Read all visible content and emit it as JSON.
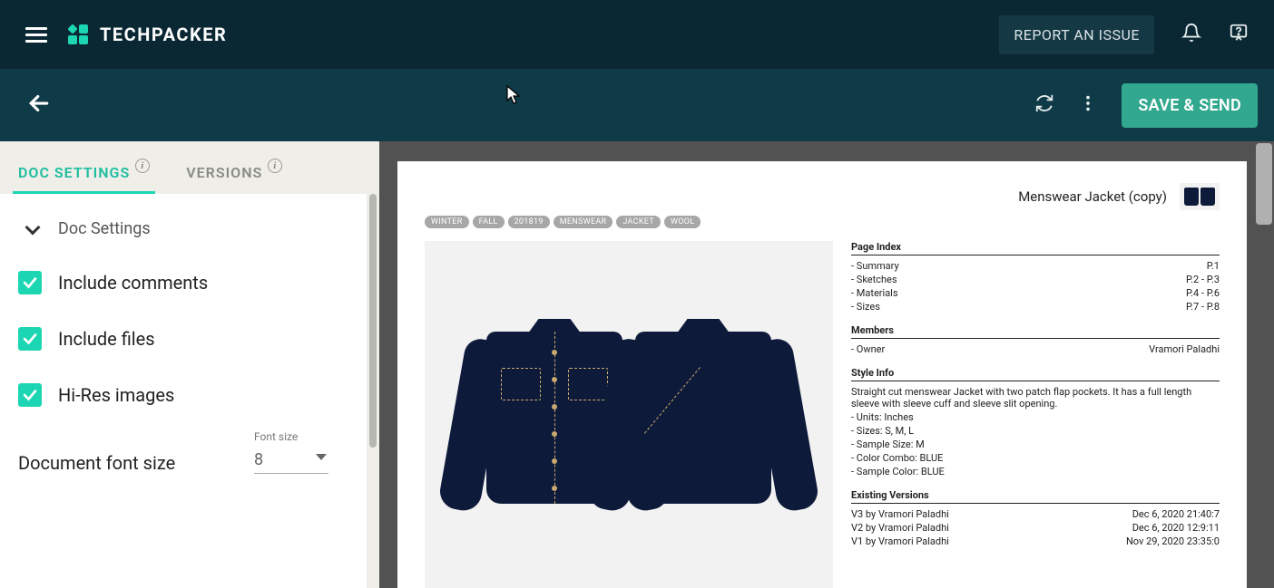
{
  "header": {
    "brand": "TECHPACKER",
    "report_label": "REPORT AN ISSUE"
  },
  "subheader": {
    "save_label": "SAVE & SEND"
  },
  "sidebar": {
    "tabs": {
      "doc_settings": "DOC SETTINGS",
      "versions": "VERSIONS"
    },
    "section_title": "Doc Settings",
    "opts": {
      "comments": "Include comments",
      "files": "Include files",
      "hires": "Hi-Res images"
    },
    "font_size_label": "Document font size",
    "font_size_field_label": "Font size",
    "font_size_value": "8"
  },
  "document": {
    "title": "Menswear Jacket (copy)",
    "tags": [
      "WINTER",
      "FALL",
      "201819",
      "MENSWEAR",
      "JACKET",
      "WOOL"
    ],
    "page_index_header": "Page Index",
    "page_index": [
      {
        "label": "Summary",
        "pages": "P.1"
      },
      {
        "label": "Sketches",
        "pages": "P.2 - P.3"
      },
      {
        "label": "Materials",
        "pages": "P.4 - P.6"
      },
      {
        "label": "Sizes",
        "pages": "P.7 - P.8"
      }
    ],
    "members_header": "Members",
    "members": [
      {
        "role": "Owner",
        "name": "Vramori Paladhi"
      }
    ],
    "style_header": "Style Info",
    "style_desc": "Straight cut menswear Jacket with two patch flap pockets. It has a full length sleeve with sleeve cuff and sleeve slit opening.",
    "style_lines": [
      "Units: Inches",
      "Sizes: S, M, L",
      "Sample Size: M",
      "Color Combo: BLUE",
      "Sample Color: BLUE"
    ],
    "versions_header": "Existing Versions",
    "versions": [
      {
        "label": "V3 by Vramori Paladhi",
        "ts": "Dec 6, 2020 21:40:7"
      },
      {
        "label": "V2 by Vramori Paladhi",
        "ts": "Dec 6, 2020 12:9:11"
      },
      {
        "label": "V1 by Vramori Paladhi",
        "ts": "Nov 29, 2020 23:35:0"
      }
    ]
  }
}
